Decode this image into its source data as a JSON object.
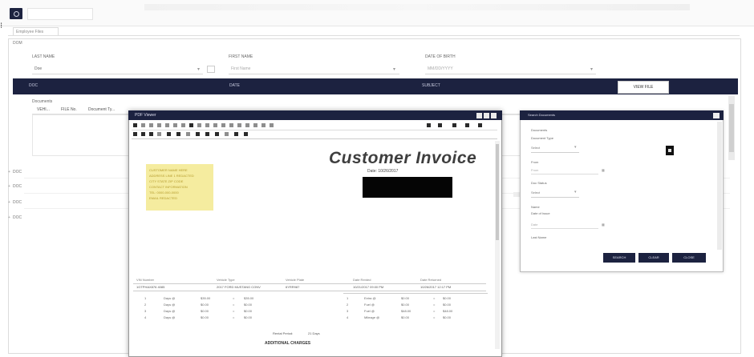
{
  "app": {
    "logo": "app-logo",
    "search_icon": "search-icon"
  },
  "tabs": [
    {
      "label": "Employee Files"
    }
  ],
  "panel": {
    "title": "DOM"
  },
  "filters": {
    "last_name_label": "LAST NAME",
    "first_name_label": "FIRST NAME",
    "date_label": "DATE OF BIRTH",
    "last_name_value": "Doe",
    "first_name_placeholder": "First Name",
    "date_placeholder": "MM/DD/YYYY"
  },
  "nav": {
    "col1": "DOC",
    "col2": "DATE",
    "col3": "SUBJECT",
    "view_button": "VIEW FILE"
  },
  "documents": {
    "label": "Documents",
    "columns": [
      "VEHI...",
      "FILE No.",
      "Document Ty..."
    ]
  },
  "row_headers": [
    "DOC",
    "DOC",
    "DOC",
    "DOC"
  ],
  "viewer": {
    "title": "PDF Viewer",
    "invoice_title": "Customer Invoice",
    "invoice_date": "Date: 10/26/2017",
    "sticky_lines": [
      "CUSTOMER NAME HERE",
      "ADDRESS LINE 1 REDACTED",
      "CITY STATE ZIP CODE",
      "CONTACT INFORMATION",
      "TEL: 0000-000-0000",
      "EMAIL REDACTED"
    ],
    "table_headers": [
      "VIN Number",
      "Vehicle Type",
      "Vehicle Plate",
      "Date Rented",
      "Date Returned"
    ],
    "table_values": [
      "1GTPHAX876 4085",
      "2017 FORD MUSTANG CONV",
      "6YRR987",
      "10/21/2017 09:00 PM",
      "10/26/2017 12:17 PM"
    ],
    "left_charges": [
      [
        "1",
        "Days @",
        "$35.00",
        "=",
        "$35.00"
      ],
      [
        "2",
        "Days @",
        "$0.00",
        "=",
        "$0.00"
      ],
      [
        "3",
        "Days @",
        "$0.00",
        "=",
        "$0.00"
      ],
      [
        "4",
        "Days @",
        "$0.00",
        "=",
        "$0.00"
      ]
    ],
    "right_charges": [
      [
        "1",
        "Extra @",
        "$0.00",
        "=",
        "$0.00"
      ],
      [
        "2",
        "Fuel @",
        "$0.00",
        "=",
        "$0.00"
      ],
      [
        "3",
        "Fuel @",
        "$48.00",
        "=",
        "$48.00"
      ],
      [
        "4",
        "Mileage @",
        "$0.00",
        "=",
        "$0.00"
      ]
    ],
    "rental_period": "Rental Period:",
    "rental_days": "21 Days",
    "footer": "ADDITIONAL CHARGES"
  },
  "search_panel": {
    "title": "Search Documents",
    "section": "Documents",
    "category_label": "Document Type",
    "category_value": "Select",
    "from_label": "From",
    "from_placeholder": "From",
    "status_label": "Doc Status",
    "status_value": "Select",
    "name_label": "Name",
    "date_label": "Date of Issue",
    "date_placeholder": "Date",
    "ref_label": "Last Name",
    "buttons": {
      "search": "SEARCH",
      "clear": "CLEAR",
      "close": "CLOSE"
    }
  }
}
